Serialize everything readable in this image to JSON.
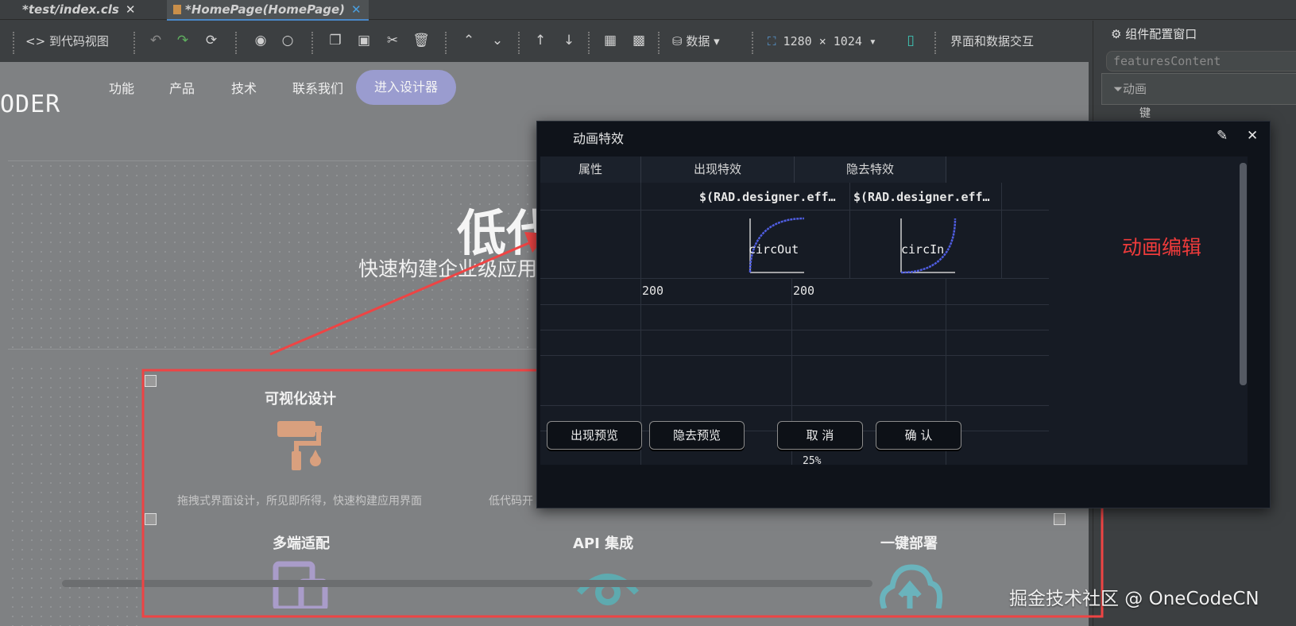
{
  "tabs": [
    {
      "label": "*test/index.cls",
      "close": "✕"
    },
    {
      "label": "*HomePage(HomePage)",
      "close": "✕"
    }
  ],
  "toolbar": {
    "code_view": "到代码视图",
    "data": "数据",
    "resolution": "1280 × 1024",
    "interaction": "界面和数据交互"
  },
  "right_panel": {
    "title": "组件配置窗口",
    "field_value": "featuresContent",
    "filter_value": "动画",
    "key_header": "键"
  },
  "canvas": {
    "nav": [
      "功能",
      "产品",
      "技术",
      "联系我们"
    ],
    "nav_button": "进入设计器",
    "logo": "ODER",
    "hero_title": "低代",
    "hero_subtitle": "快速构建企业级应用",
    "features": [
      {
        "title": "可视化设计",
        "desc": "拖拽式界面设计，所见即所得，快速构建应用界面"
      },
      {
        "title": "",
        "desc": "低代码开"
      },
      {
        "title": "多端适配",
        "desc": ""
      },
      {
        "title": "API 集成",
        "desc": ""
      },
      {
        "title": "一键部署",
        "desc": ""
      }
    ]
  },
  "dialog": {
    "title": "动画特效",
    "columns": [
      "属性",
      "出现特效",
      "隐去特效"
    ],
    "row_expr": [
      "$(RAD.designer.eff…",
      "$(RAD.designer.eff…"
    ],
    "curves": [
      "circOut",
      "circIn"
    ],
    "durations": [
      "200",
      "200"
    ],
    "partial_cell": "25%",
    "buttons": {
      "show_preview": "出现预览",
      "hide_preview": "隐去预览",
      "cancel": "取 消",
      "confirm": "确 认"
    }
  },
  "annotation": "动画编辑",
  "watermark": "掘金技术社区 @ OneCodeCN",
  "colors": {
    "annotation_red": "#ee4444",
    "nav_button": "#9a9ccf",
    "dialog_bg": "#0f131a",
    "curve": "#4f5de0"
  }
}
